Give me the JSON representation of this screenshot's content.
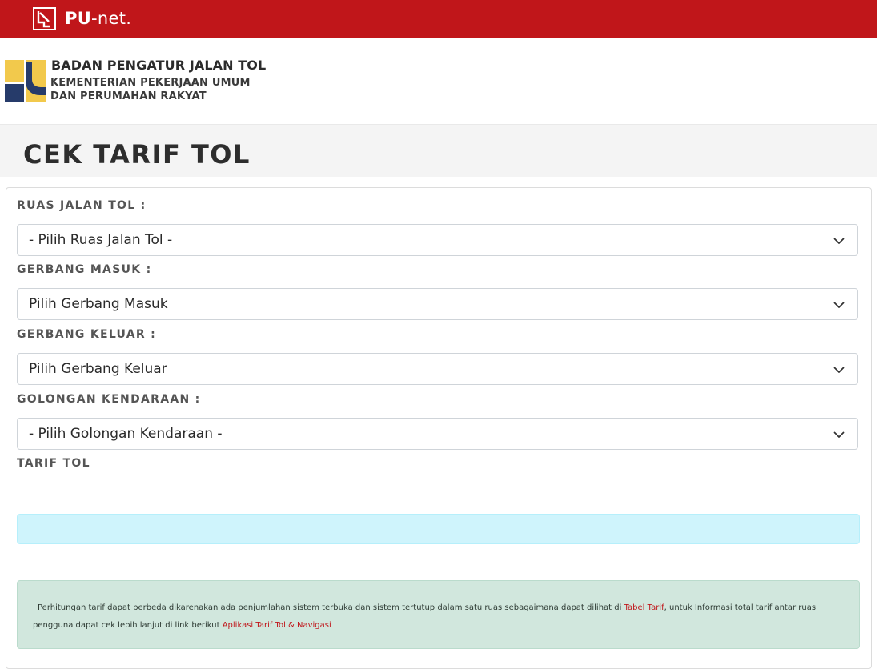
{
  "topbar": {
    "brand_bold": "PU",
    "brand_light": "-net."
  },
  "logo": {
    "title": "BADAN PENGATUR JALAN TOL",
    "subtitle_line1": "KEMENTERIAN PEKERJAAN UMUM",
    "subtitle_line2": "DAN PERUMAHAN RAKYAT"
  },
  "page": {
    "title": "CEK TARIF TOL"
  },
  "form": {
    "ruas": {
      "label": "RUAS JALAN TOL :",
      "selected": "- Pilih Ruas Jalan Tol -"
    },
    "gerbang_masuk": {
      "label": "GERBANG MASUK :",
      "selected": "Pilih Gerbang Masuk"
    },
    "gerbang_keluar": {
      "label": "GERBANG KELUAR :",
      "selected": "Pilih Gerbang Keluar"
    },
    "golongan": {
      "label": "GOLONGAN KENDARAAN :",
      "selected": "- Pilih Golongan Kendaraan -"
    },
    "tarif_label": "TARIF TOL",
    "tarif_value": ""
  },
  "info": {
    "text_part1": "Perhitungan tarif dapat berbeda dikarenakan ada penjumlahan sistem terbuka dan sistem tertutup dalam satu ruas sebagaimana dapat dilihat di",
    "link1": "Tabel Tarif",
    "text_part2": ", untuk Informasi total tarif antar ruas pengguna dapat cek lebih lanjut di link berikut",
    "link2": "Aplikasi Tarif Tol & Navigasi"
  },
  "icons": {
    "pu_logo": "pu-net-logo-icon",
    "emblem": "bpjt-emblem-icon",
    "dropdown": "chevron-down-icon"
  },
  "colors": {
    "brand_red": "#c0161a",
    "emblem_yellow": "#f2c94c",
    "emblem_navy": "#263b6a",
    "alert_info": "#cff4fc",
    "alert_success": "#d1e7dd"
  }
}
